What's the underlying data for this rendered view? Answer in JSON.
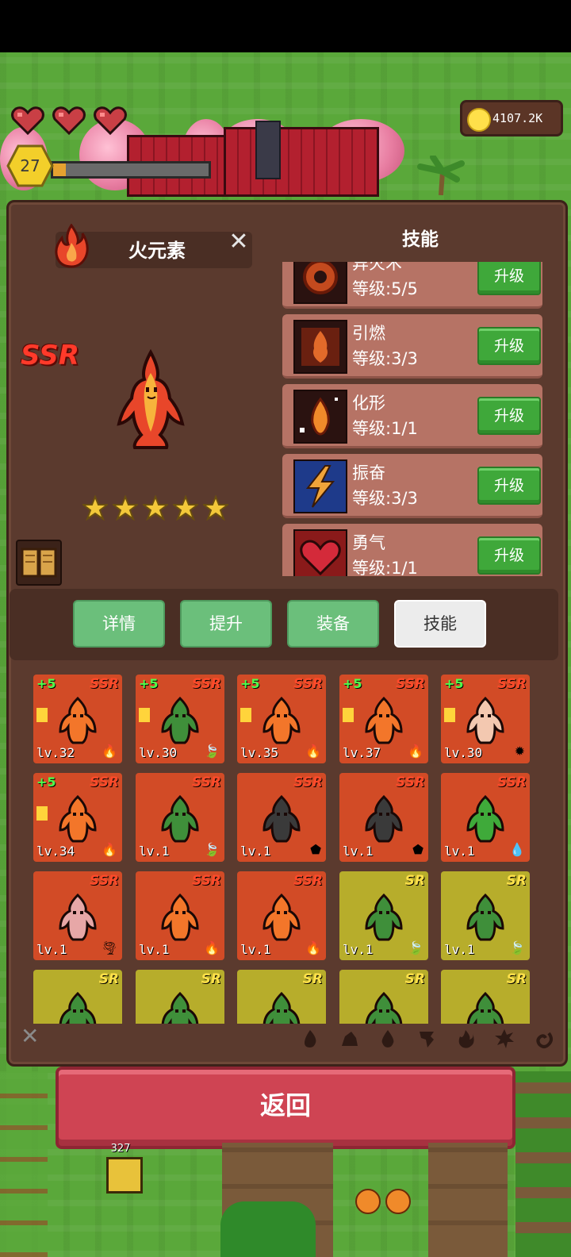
{
  "hud": {
    "level": "27",
    "coins": "4107.2K",
    "hearts": 3,
    "xp_fraction": 0.08
  },
  "hero": {
    "name": "火元素",
    "rarity": "SSR",
    "stars": 5
  },
  "skills_header": "技能",
  "skills": [
    {
      "name": "异火术",
      "level": "等级:5/5",
      "button": "升级"
    },
    {
      "name": "引燃",
      "level": "等级:3/3",
      "button": "升级"
    },
    {
      "name": "化形",
      "level": "等级:1/1",
      "button": "升级"
    },
    {
      "name": "振奋",
      "level": "等级:3/3",
      "button": "升级"
    },
    {
      "name": "勇气",
      "level": "等级:1/1",
      "button": "升级"
    }
  ],
  "tabs": [
    "详情",
    "提升",
    "装备",
    "技能"
  ],
  "roster": [
    {
      "rarity": "SSR",
      "plus": "+5",
      "lvl": "lv.32",
      "elem": "fire",
      "flag": true
    },
    {
      "rarity": "SSR",
      "plus": "+5",
      "lvl": "lv.30",
      "elem": "leaf",
      "flag": true
    },
    {
      "rarity": "SSR",
      "plus": "+5",
      "lvl": "lv.35",
      "elem": "fire",
      "flag": true
    },
    {
      "rarity": "SSR",
      "plus": "+5",
      "lvl": "lv.37",
      "elem": "fire",
      "flag": true
    },
    {
      "rarity": "SSR",
      "plus": "+5",
      "lvl": "lv.30",
      "elem": "sun",
      "flag": true
    },
    {
      "rarity": "SSR",
      "plus": "+5",
      "lvl": "lv.34",
      "elem": "fire",
      "flag": true
    },
    {
      "rarity": "SSR",
      "plus": "",
      "lvl": "lv.1",
      "elem": "leaf",
      "flag": false
    },
    {
      "rarity": "SSR",
      "plus": "",
      "lvl": "lv.1",
      "elem": "rock",
      "flag": false
    },
    {
      "rarity": "SSR",
      "plus": "",
      "lvl": "lv.1",
      "elem": "rock",
      "flag": false
    },
    {
      "rarity": "SSR",
      "plus": "",
      "lvl": "lv.1",
      "elem": "water",
      "flag": false
    },
    {
      "rarity": "SSR",
      "plus": "",
      "lvl": "lv.1",
      "elem": "wind",
      "flag": false
    },
    {
      "rarity": "SSR",
      "plus": "",
      "lvl": "lv.1",
      "elem": "fire",
      "flag": false
    },
    {
      "rarity": "SSR",
      "plus": "",
      "lvl": "lv.1",
      "elem": "fire",
      "flag": false
    },
    {
      "rarity": "SR",
      "plus": "",
      "lvl": "lv.1",
      "elem": "leaf",
      "flag": false
    },
    {
      "rarity": "SR",
      "plus": "",
      "lvl": "lv.1",
      "elem": "leaf",
      "flag": false
    },
    {
      "rarity": "SR",
      "plus": "",
      "lvl": "",
      "elem": "",
      "flag": false
    },
    {
      "rarity": "SR",
      "plus": "",
      "lvl": "",
      "elem": "",
      "flag": false
    },
    {
      "rarity": "SR",
      "plus": "",
      "lvl": "",
      "elem": "",
      "flag": false
    },
    {
      "rarity": "SR",
      "plus": "",
      "lvl": "",
      "elem": "",
      "flag": false
    },
    {
      "rarity": "SR",
      "plus": "",
      "lvl": "",
      "elem": "",
      "flag": false
    }
  ],
  "return_button": "返回",
  "ground_counter": "327",
  "colors": {
    "ssr_card": "#d24b26",
    "sr_card": "#b7ad2b",
    "upgrade_green": "#3fa83a",
    "return_red": "#cf4453"
  }
}
